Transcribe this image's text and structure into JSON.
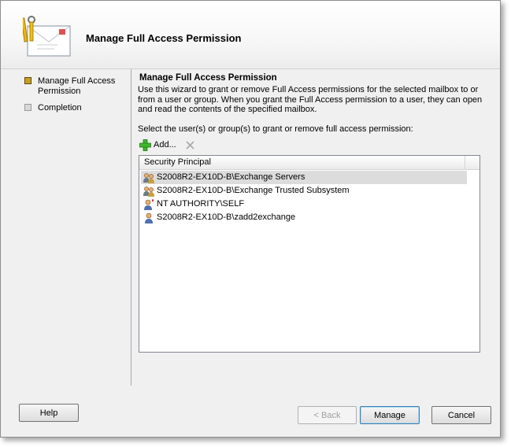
{
  "header": {
    "title": "Manage Full Access Permission",
    "icon": "wizard-mail-tools-icon"
  },
  "nav": {
    "items": [
      {
        "label": "Manage Full Access\nPermission",
        "state": "active"
      },
      {
        "label": "Completion",
        "state": "inactive"
      }
    ]
  },
  "content": {
    "title": "Manage Full Access Permission",
    "description": "Use this wizard to grant or remove Full Access permissions for the selected mailbox to or from a user or group. When you grant the Full Access permission to a user, they can open and read the contents of the specified mailbox.",
    "select_label": "Select the user(s) or group(s) to grant or remove full access permission:",
    "toolbar": {
      "add_label": "Add...",
      "add_icon": "add-plus-icon",
      "remove_icon": "remove-x-icon"
    }
  },
  "list": {
    "column_header": "Security Principal",
    "rows": [
      {
        "name": "S2008R2-EX10D-B\\Exchange Servers",
        "icon": "group-icon",
        "selected": true
      },
      {
        "name": "S2008R2-EX10D-B\\Exchange Trusted Subsystem",
        "icon": "group-icon",
        "selected": false
      },
      {
        "name": "NT AUTHORITY\\SELF",
        "icon": "user-special-icon",
        "selected": false
      },
      {
        "name": "S2008R2-EX10D-B\\zadd2exchange",
        "icon": "user-icon",
        "selected": false
      }
    ]
  },
  "buttons": {
    "help": "Help",
    "back": "< Back",
    "manage": "Manage",
    "cancel": "Cancel"
  },
  "colors": {
    "window_bg": "#f0f0f0",
    "selected_row": "#dcdcdc",
    "active_step": "#c8a020",
    "add_icon": "#2e9e1e"
  }
}
